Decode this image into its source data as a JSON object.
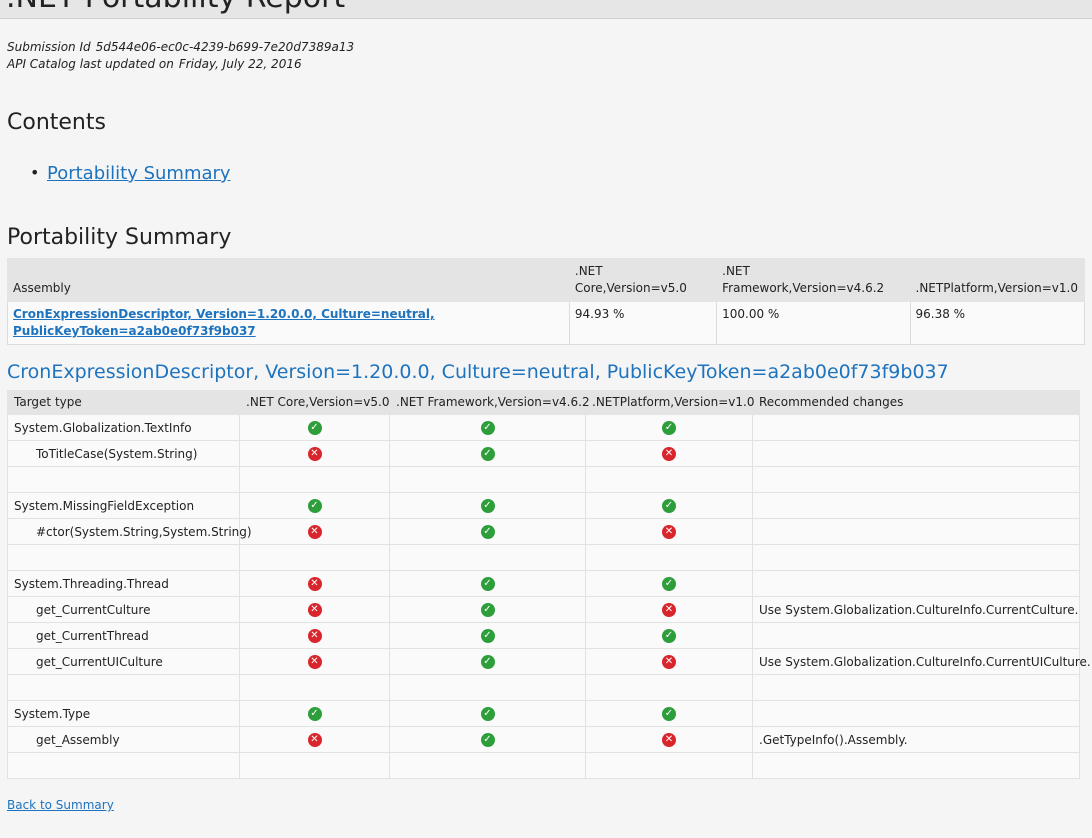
{
  "header": {
    "title": ".NET Portability Report"
  },
  "meta": {
    "submission_label": "Submission Id",
    "submission_value": "5d544e06-ec0c-4239-b699-7e20d7389a13",
    "catalog_label": "API Catalog last updated on",
    "catalog_value": "Friday, July 22, 2016"
  },
  "contents": {
    "title": "Contents",
    "items": [
      {
        "label": "Portability Summary"
      }
    ]
  },
  "summary": {
    "title": "Portability Summary",
    "columns": [
      "Assembly",
      ".NET Core,Version=v5.0",
      ".NET Framework,Version=v4.6.2",
      ".NETPlatform,Version=v1.0"
    ],
    "column_lines": [
      [
        "Assembly"
      ],
      [
        ".NET",
        "Core,Version=v5.0"
      ],
      [
        ".NET",
        "Framework,Version=v4.6.2"
      ],
      [
        ".NETPlatform,Version=v1.0"
      ]
    ],
    "rows": [
      {
        "assembly_line1": "CronExpressionDescriptor, Version=1.20.0.0, Culture=neutral,",
        "assembly_line2": "PublicKeyToken=a2ab0e0f73f9b037",
        "values": [
          "94.93 %",
          "100.00 %",
          "96.38 %"
        ]
      }
    ]
  },
  "detail": {
    "heading": "CronExpressionDescriptor, Version=1.20.0.0, Culture=neutral, PublicKeyToken=a2ab0e0f73f9b037",
    "columns": [
      "Target type",
      ".NET Core,Version=v5.0",
      ".NET Framework,Version=v4.6.2",
      ".NETPlatform,Version=v1.0",
      "Recommended changes"
    ],
    "rows": [
      {
        "name": "System.Globalization.TextInfo",
        "indent": false,
        "status": [
          "ok",
          "ok",
          "ok"
        ],
        "rec": ""
      },
      {
        "name": "ToTitleCase(System.String)",
        "indent": true,
        "status": [
          "no",
          "ok",
          "no"
        ],
        "rec": ""
      },
      {
        "name": "",
        "indent": false,
        "status": [
          "",
          "",
          ""
        ],
        "rec": ""
      },
      {
        "name": "System.MissingFieldException",
        "indent": false,
        "status": [
          "ok",
          "ok",
          "ok"
        ],
        "rec": ""
      },
      {
        "name": "#ctor(System.String,System.String)",
        "indent": true,
        "status": [
          "no",
          "ok",
          "no"
        ],
        "rec": ""
      },
      {
        "name": "",
        "indent": false,
        "status": [
          "",
          "",
          ""
        ],
        "rec": ""
      },
      {
        "name": "System.Threading.Thread",
        "indent": false,
        "status": [
          "no",
          "ok",
          "ok"
        ],
        "rec": ""
      },
      {
        "name": "get_CurrentCulture",
        "indent": true,
        "status": [
          "no",
          "ok",
          "no"
        ],
        "rec": "Use System.Globalization.CultureInfo.CurrentCulture."
      },
      {
        "name": "get_CurrentThread",
        "indent": true,
        "status": [
          "no",
          "ok",
          "ok"
        ],
        "rec": ""
      },
      {
        "name": "get_CurrentUICulture",
        "indent": true,
        "status": [
          "no",
          "ok",
          "no"
        ],
        "rec": "Use System.Globalization.CultureInfo.CurrentUICulture."
      },
      {
        "name": "",
        "indent": false,
        "status": [
          "",
          "",
          ""
        ],
        "rec": ""
      },
      {
        "name": "System.Type",
        "indent": false,
        "status": [
          "ok",
          "ok",
          "ok"
        ],
        "rec": ""
      },
      {
        "name": "get_Assembly",
        "indent": true,
        "status": [
          "no",
          "ok",
          "no"
        ],
        "rec": ".GetTypeInfo().Assembly."
      },
      {
        "name": "",
        "indent": false,
        "status": [
          "",
          "",
          ""
        ],
        "rec": ""
      }
    ]
  },
  "footer": {
    "back_label": "Back to Summary"
  },
  "colors": {
    "link": "#1e73be",
    "ok": "#2e9e3b",
    "no": "#d9262c"
  },
  "icons": {
    "ok": "check-icon",
    "no": "cross-icon"
  }
}
